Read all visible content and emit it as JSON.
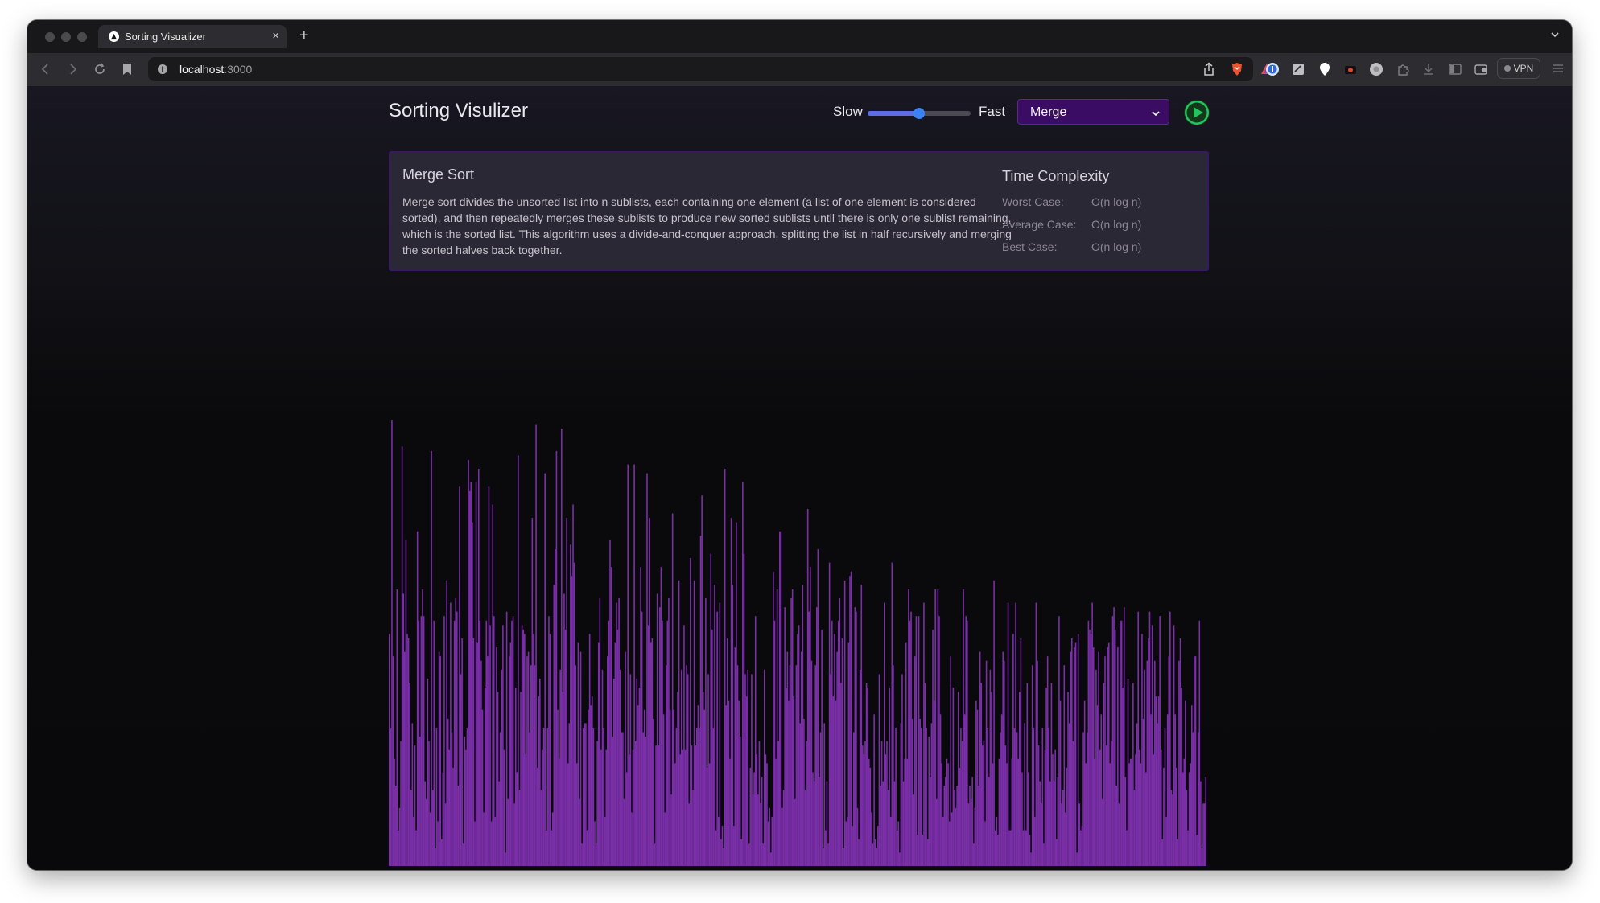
{
  "browser": {
    "tab_title": "Sorting Visualizer",
    "tab_close": "×",
    "new_tab": "+",
    "url_host": "localhost",
    "url_port": ":3000",
    "vpn_label": "VPN"
  },
  "header": {
    "title": "Sorting Visulizer",
    "speed_slow": "Slow",
    "speed_fast": "Fast",
    "speed_value": 0.5,
    "algorithm_selected": "Merge"
  },
  "info": {
    "title": "Merge Sort",
    "description": "Merge sort divides the unsorted list into n sublists, each containing one element (a list of one element is considered sorted), and then repeatedly merges these sublists to produce new sorted sublists until there is only one sublist remaining, which is the sorted list. This algorithm uses a divide-and-conquer approach, splitting the list in half recursively and merging the sorted halves back together.",
    "complexity_title": "Time Complexity",
    "complexity": [
      {
        "label": "Worst Case:",
        "value": "O(n log n)"
      },
      {
        "label": "Average Case:",
        "value": "O(n log n)"
      },
      {
        "label": "Best Case:",
        "value": "O(n log n)"
      }
    ]
  },
  "colors": {
    "bar": "#7a2fa8",
    "accent": "#3b82f6",
    "play": "#22c55e",
    "select_bg": "#3b0c63"
  },
  "chart_data": {
    "type": "bar",
    "values": [
      52,
      31,
      100,
      47,
      24,
      18,
      62,
      8,
      13,
      28,
      94,
      61,
      48,
      73,
      52,
      51,
      41,
      17,
      32,
      11,
      27,
      8,
      75,
      55,
      29,
      56,
      62,
      56,
      19,
      15,
      42,
      28,
      12,
      93,
      17,
      55,
      4,
      31,
      10,
      48,
      47,
      6,
      21,
      56,
      14,
      64,
      33,
      26,
      59,
      30,
      22,
      55,
      60,
      57,
      18,
      85,
      43,
      51,
      5,
      29,
      26,
      31,
      91,
      84,
      86,
      77,
      51,
      10,
      86,
      50,
      89,
      55,
      46,
      35,
      12,
      40,
      55,
      47,
      85,
      54,
      10,
      81,
      56,
      11,
      49,
      39,
      19,
      30,
      44,
      54,
      26,
      3,
      57,
      15,
      47,
      50,
      55,
      56,
      14,
      40,
      21,
      92,
      17,
      39,
      54,
      53,
      52,
      25,
      47,
      48,
      30,
      45,
      78,
      52,
      45,
      99,
      22,
      38,
      42,
      17,
      26,
      31,
      88,
      8,
      31,
      56,
      52,
      8,
      12,
      63,
      71,
      93,
      35,
      24,
      44,
      98,
      39,
      61,
      53,
      78,
      23,
      32,
      72,
      65,
      81,
      68,
      45,
      23,
      50,
      15,
      48,
      5,
      31,
      32,
      32,
      8,
      35,
      52,
      36,
      38,
      31,
      10,
      5,
      28,
      50,
      60,
      26,
      44,
      31,
      11,
      26,
      47,
      55,
      73,
      67,
      29,
      42,
      50,
      59,
      53,
      60,
      44,
      30,
      30,
      15,
      48,
      21,
      90,
      25,
      43,
      12,
      26,
      90,
      28,
      42,
      36,
      40,
      67,
      57,
      30,
      35,
      29,
      88,
      54,
      78,
      50,
      51,
      33,
      5,
      27,
      61,
      27,
      58,
      67,
      55,
      34,
      12,
      45,
      55,
      60,
      35,
      16,
      79,
      35,
      23,
      31,
      39,
      64,
      25,
      44,
      26,
      54,
      26,
      45,
      43,
      14,
      69,
      27,
      17,
      64,
      27,
      31,
      36,
      31,
      74,
      83,
      39,
      35,
      60,
      22,
      43,
      23,
      70,
      53,
      31,
      63,
      8,
      57,
      11,
      59,
      6,
      9,
      4,
      89,
      36,
      51,
      37,
      24,
      78,
      63,
      9,
      49,
      77,
      45,
      37,
      29,
      6,
      86,
      70,
      43,
      38,
      44,
      5,
      22,
      43,
      16,
      21,
      56,
      25,
      16,
      28,
      14,
      20,
      5,
      44,
      25,
      23,
      10,
      13,
      3,
      11,
      66,
      55,
      24,
      62,
      28,
      75,
      75,
      13,
      17,
      58,
      40,
      48,
      37,
      45,
      60,
      62,
      38,
      15,
      45,
      52,
      54,
      32,
      48,
      63,
      33,
      17,
      28,
      80,
      57,
      67,
      46,
      21,
      19,
      45,
      58,
      71,
      20,
      30,
      53,
      4,
      32,
      8,
      19,
      5,
      68,
      43,
      55,
      38,
      52,
      37,
      48,
      55,
      60,
      41,
      51,
      4,
      64,
      10,
      11,
      50,
      65,
      66,
      9,
      30,
      58,
      57,
      13,
      6,
      44,
      63,
      27,
      25,
      28,
      41,
      40,
      24,
      22,
      12,
      5,
      34,
      6,
      4,
      9,
      43,
      18,
      28,
      19,
      59,
      25,
      28,
      17,
      40,
      11,
      68,
      45,
      19,
      31,
      8,
      10,
      3,
      32,
      43,
      19,
      24,
      50,
      24,
      62,
      55,
      57,
      33,
      16,
      47,
      56,
      7,
      56,
      33,
      31,
      7,
      59,
      41,
      31,
      6,
      29,
      20,
      32,
      53,
      37,
      62,
      15,
      62,
      56,
      34,
      23,
      11,
      18,
      20,
      24,
      23,
      10,
      47,
      12,
      40,
      17,
      13,
      18,
      39,
      22,
      31,
      28,
      62,
      34,
      56,
      55,
      14,
      18,
      15,
      20,
      5,
      13,
      37,
      35,
      18,
      48,
      41,
      27,
      28,
      10,
      46,
      31,
      20,
      44,
      39,
      23,
      64,
      8,
      11,
      7,
      24,
      30,
      34,
      48,
      46,
      27,
      23,
      59,
      8,
      8,
      24,
      52,
      31,
      59,
      30,
      24,
      39,
      51,
      21,
      8,
      32,
      8,
      41,
      21,
      7,
      3,
      45,
      31,
      11,
      59,
      46,
      27,
      19,
      14,
      31,
      5,
      26,
      40,
      47,
      31,
      19,
      41,
      25,
      19,
      26,
      6,
      20,
      56,
      37,
      14,
      17,
      45,
      12,
      22,
      39,
      32,
      48,
      51,
      28,
      49,
      50,
      3,
      52,
      14,
      8,
      9,
      30,
      37,
      23,
      30,
      55,
      53,
      52,
      59,
      49,
      24,
      44,
      36,
      48,
      26,
      34,
      15,
      41,
      47,
      27,
      49,
      50,
      23,
      28,
      56,
      58,
      53,
      18,
      49,
      14,
      55,
      55,
      40,
      58,
      20,
      8,
      42,
      23,
      24,
      24,
      41,
      17,
      25,
      32,
      57,
      26,
      23,
      52,
      33,
      44,
      21,
      46,
      51,
      57,
      34,
      54,
      25,
      46,
      38,
      32,
      38,
      56,
      26,
      6,
      22,
      31,
      11,
      34,
      47,
      57,
      17,
      16,
      54,
      34,
      22,
      6,
      46,
      51,
      40,
      21,
      24,
      37,
      17,
      8,
      21,
      23,
      36,
      30,
      47,
      47,
      7,
      30,
      55,
      19,
      4,
      14,
      14,
      20
    ],
    "ylim": [
      0,
      100
    ]
  }
}
